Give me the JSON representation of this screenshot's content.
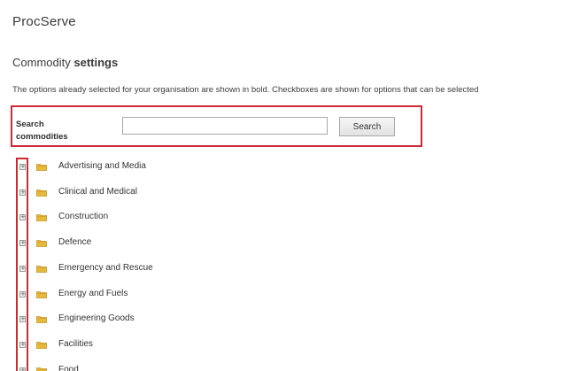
{
  "app": {
    "title": "ProcServe"
  },
  "page": {
    "title_prefix": "Commodity ",
    "title_bold": "settings",
    "description": "The options already selected for your organisation are shown in bold. Checkboxes are shown for options that can be selected"
  },
  "search": {
    "label": "Search commodities",
    "input_value": "",
    "button_label": "Search"
  },
  "tree": {
    "expander_symbol": "+",
    "items": [
      {
        "label": "Advertising and Media"
      },
      {
        "label": "Clinical and Medical"
      },
      {
        "label": "Construction"
      },
      {
        "label": "Defence"
      },
      {
        "label": "Emergency and Rescue"
      },
      {
        "label": "Energy and Fuels"
      },
      {
        "label": "Engineering Goods"
      },
      {
        "label": "Facilities"
      },
      {
        "label": "Food"
      }
    ]
  },
  "colors": {
    "highlight": "#cc2a35",
    "folder": "#e8b83a",
    "folder_dark": "#c9962a"
  }
}
